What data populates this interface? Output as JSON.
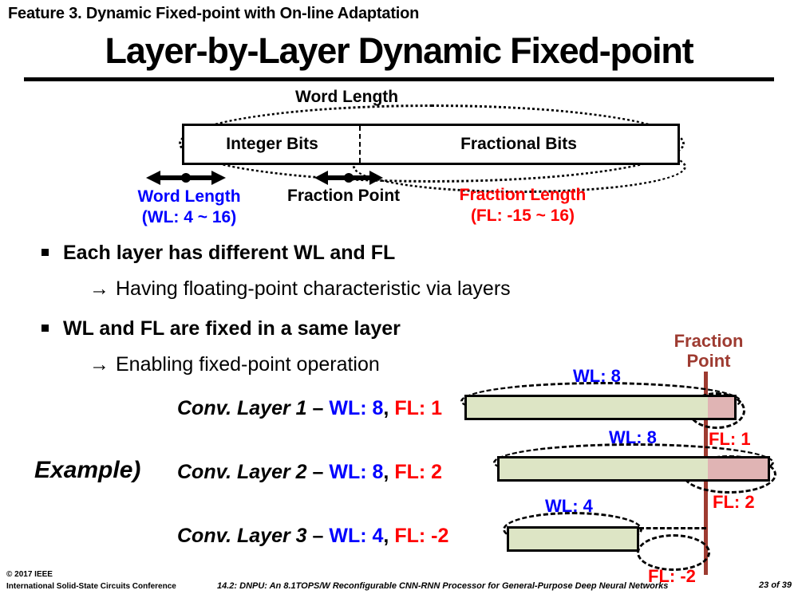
{
  "header": {
    "feature_line": "Feature 3. Dynamic Fixed-point with On-line Adaptation",
    "title": "Layer-by-Layer Dynamic Fixed-point"
  },
  "word_diagram": {
    "word_length_caption": "Word Length",
    "integer_bits_label": "Integer Bits",
    "fractional_bits_label": "Fractional Bits",
    "word_length_name": "Word Length",
    "word_length_range": "(WL: 4 ~ 16)",
    "fraction_point_label": "Fraction Point",
    "fraction_length_name": "Fraction Length",
    "fraction_length_range": "(FL: -15 ~ 16)",
    "colors": {
      "word_length": "#0000ff",
      "fraction_length": "#ff0000",
      "box_border": "#000000"
    }
  },
  "bullets": [
    {
      "text": "Each layer has different WL and FL",
      "sub": "Having floating-point characteristic via layers"
    },
    {
      "text": "WL and FL are fixed in a same layer",
      "sub": "Enabling fixed-point operation"
    }
  ],
  "sub_arrow_glyph": "→",
  "example": {
    "label": "Example)",
    "layers": [
      {
        "name": "Conv. Layer 1",
        "dash": " – ",
        "wl_label": "WL: 8",
        "separator": ", ",
        "fl_label": "FL: 1",
        "wl_value": 8,
        "fl_value": 1
      },
      {
        "name": "Conv. Layer 2",
        "dash": " – ",
        "wl_label": "WL: 8",
        "separator": ", ",
        "fl_label": "FL: 2",
        "wl_value": 8,
        "fl_value": 2
      },
      {
        "name": "Conv. Layer 3",
        "dash": " – ",
        "wl_label": "WL: 4",
        "separator": ", ",
        "fl_label": "FL: -2",
        "wl_value": 4,
        "fl_value": -2
      }
    ]
  },
  "bar_diagram": {
    "fraction_point_title_line1": "Fraction",
    "fraction_point_title_line2": "Point",
    "fraction_point_color": "#9e3b31",
    "integer_color": "#dde5c5",
    "fraction_color": "#e0b4b4",
    "bars": [
      {
        "wl_label": "WL: 8",
        "fl_label": "FL: 1"
      },
      {
        "wl_label": "WL: 8",
        "fl_label": "FL: 2"
      },
      {
        "wl_label": "WL: 4",
        "fl_label": "FL: -2"
      }
    ]
  },
  "footer": {
    "copyright_line1": "© 2017 IEEE",
    "copyright_line2": "International Solid-State Circuits Conference",
    "paper_title": "14.2: DNPU: An 8.1TOPS/W Reconfigurable CNN-RNN Processor for General-Purpose Deep Neural Networks",
    "page": "23 of 39"
  }
}
